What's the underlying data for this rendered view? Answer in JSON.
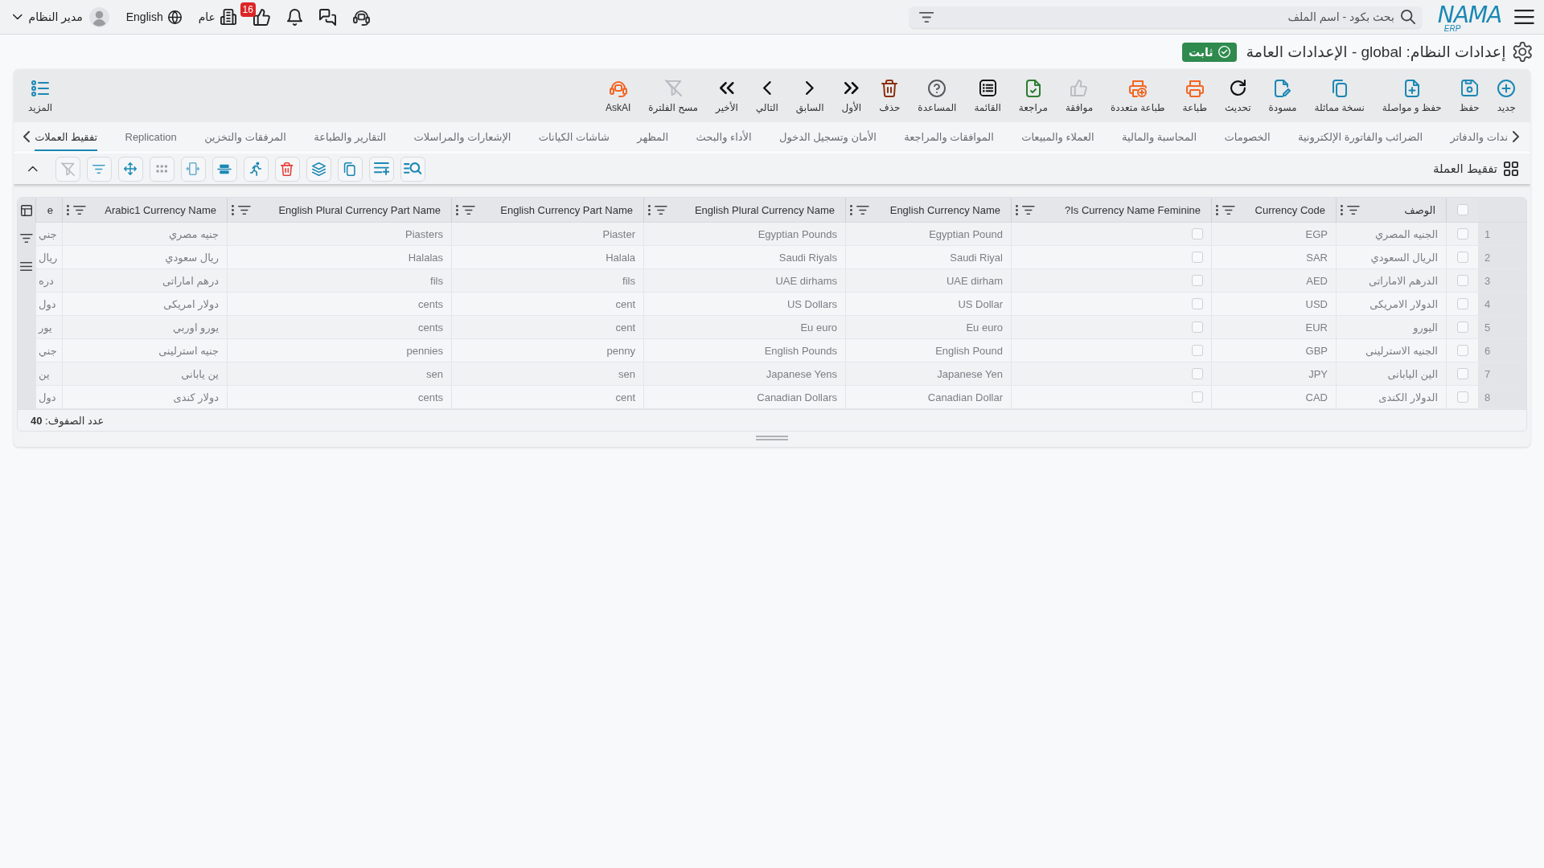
{
  "top_bar": {
    "logo": {
      "wordmark": "NAMA",
      "suffix": "ERP"
    },
    "search": {
      "placeholder": "بحث بكود - اسم الملف"
    },
    "approvals_badge": "16",
    "branch": "عام",
    "language": "English",
    "user": "مدير النظام"
  },
  "page": {
    "title": "إعدادات النظام: global - الإعدادات العامة",
    "status": "ثابت"
  },
  "toolbar": {
    "buttons": [
      {
        "kind": "new",
        "label": "جديد",
        "disabled": false
      },
      {
        "kind": "save",
        "label": "حفظ",
        "disabled": false
      },
      {
        "kind": "savenext",
        "label": "حفظ و مواصلة",
        "disabled": false
      },
      {
        "kind": "duplicate",
        "label": "نسخة مماثلة",
        "disabled": false
      },
      {
        "kind": "draft",
        "label": "مسودة",
        "disabled": false
      },
      {
        "kind": "refresh",
        "label": "تحديث",
        "disabled": false
      },
      {
        "kind": "print",
        "label": "طباعة",
        "disabled": false
      },
      {
        "kind": "multiprint",
        "label": "طباعة متعددة",
        "disabled": false
      },
      {
        "kind": "approve",
        "label": "موافقة",
        "disabled": true
      },
      {
        "kind": "review",
        "label": "مراجعة",
        "disabled": false
      },
      {
        "kind": "list",
        "label": "القائمة",
        "disabled": false
      },
      {
        "kind": "help",
        "label": "المساعدة",
        "disabled": false
      },
      {
        "kind": "delete",
        "label": "حذف",
        "disabled": false
      },
      {
        "kind": "first",
        "label": "الأول",
        "disabled": false
      },
      {
        "kind": "previous",
        "label": "السابق",
        "disabled": false
      },
      {
        "kind": "next",
        "label": "التالي",
        "disabled": false
      },
      {
        "kind": "last",
        "label": "الأخير",
        "disabled": false
      },
      {
        "kind": "clearfilter",
        "label": "مسح الفلترة",
        "disabled": true
      },
      {
        "kind": "askai",
        "label": "AskAI",
        "disabled": false
      }
    ],
    "more": "المزيد"
  },
  "tabs": [
    {
      "label": "ندات والدفاتر",
      "selected": false
    },
    {
      "label": "الضرائب والفاتورة الإلكترونية",
      "selected": false
    },
    {
      "label": "الخصومات",
      "selected": false
    },
    {
      "label": "المحاسبة والمالية",
      "selected": false
    },
    {
      "label": "العملاء والمبيعات",
      "selected": false
    },
    {
      "label": "الموافقات والمراجعة",
      "selected": false
    },
    {
      "label": "الأمان وتسجيل الدخول",
      "selected": false
    },
    {
      "label": "الأداء والبحث",
      "selected": false
    },
    {
      "label": "المظهر",
      "selected": false
    },
    {
      "label": "شاشات الكيانات",
      "selected": false
    },
    {
      "label": "الإشعارات والمراسلات",
      "selected": false
    },
    {
      "label": "التقارير والطباعة",
      "selected": false
    },
    {
      "label": "المرفقات والتخزين",
      "selected": false
    },
    {
      "label": "Replication",
      "selected": false
    },
    {
      "label": "تفقيط العملات",
      "selected": true
    }
  ],
  "section": {
    "title": "تفقيط العملة",
    "expanded": true,
    "tools": [
      {
        "kind": "searchlist",
        "disabled": false
      },
      {
        "kind": "addrow",
        "disabled": false
      },
      {
        "kind": "copy",
        "disabled": false
      },
      {
        "kind": "layers",
        "disabled": false
      },
      {
        "kind": "delete",
        "disabled": false
      },
      {
        "kind": "run",
        "disabled": false
      },
      {
        "kind": "freeze",
        "disabled": false
      },
      {
        "kind": "fit",
        "disabled": false
      },
      {
        "kind": "dots",
        "disabled": false
      },
      {
        "kind": "move",
        "disabled": false
      },
      {
        "kind": "filter",
        "disabled": false
      },
      {
        "kind": "clearfilter",
        "disabled": true
      }
    ]
  },
  "grid": {
    "all_selected": false,
    "columns": [
      {
        "kind": "text",
        "label": "الوصف"
      },
      {
        "kind": "text",
        "label": "Currency Code"
      },
      {
        "kind": "check",
        "label": "Is Currency Name Feminine?"
      },
      {
        "kind": "text",
        "label": "English Currency Name"
      },
      {
        "kind": "text",
        "label": "English Plural Currency Name"
      },
      {
        "kind": "text",
        "label": "English Currency Part Name"
      },
      {
        "kind": "text",
        "label": "English Plural Currency Part Name"
      },
      {
        "kind": "text",
        "label": "Arabic1 Currency Name"
      },
      {
        "kind": "text",
        "label": "e"
      }
    ],
    "rows": [
      {
        "number": "1",
        "selected": false,
        "cells": [
          "الجنيه المصري",
          "EGP",
          {
            "checked": false
          },
          "Egyptian Pound",
          "Egyptian Pounds",
          "Piaster",
          "Piasters",
          "جنيه مصري",
          "جني"
        ]
      },
      {
        "number": "2",
        "selected": false,
        "cells": [
          "الريال السعودي",
          "SAR",
          {
            "checked": false
          },
          "Saudi Riyal",
          "Saudi Riyals",
          "Halala",
          "Halalas",
          "ريال سعودي",
          "ريال"
        ]
      },
      {
        "number": "3",
        "selected": false,
        "cells": [
          "الدرهم الاماراتى",
          "AED",
          {
            "checked": false
          },
          "UAE dirham",
          "UAE dirhams",
          "fils",
          "fils",
          "درهم اماراتى",
          "دره"
        ]
      },
      {
        "number": "4",
        "selected": false,
        "cells": [
          "الدولار الامريكى",
          "USD",
          {
            "checked": false
          },
          "US Dollar",
          "US Dollars",
          "cent",
          "cents",
          "دولار امريكى",
          "دول"
        ]
      },
      {
        "number": "5",
        "selected": false,
        "cells": [
          "اليورو",
          "EUR",
          {
            "checked": false
          },
          "Eu euro",
          "Eu euro",
          "cent",
          "cents",
          "يورو اوربي",
          "يور"
        ]
      },
      {
        "number": "6",
        "selected": false,
        "cells": [
          "الجنيه الاسترلينى",
          "GBP",
          {
            "checked": false
          },
          "English Pound",
          "English Pounds",
          "penny",
          "pennies",
          "جنيه استرلينى",
          "جني"
        ]
      },
      {
        "number": "7",
        "selected": false,
        "cells": [
          "الين اليابانى",
          "JPY",
          {
            "checked": false
          },
          "Japanese Yen",
          "Japanese Yens",
          "sen",
          "sen",
          "ين يابانى",
          "ين"
        ]
      },
      {
        "number": "8",
        "selected": false,
        "cells": [
          "الدولار الكندى",
          "CAD",
          {
            "checked": false
          },
          "Canadian Dollar",
          "Canadian Dollars",
          "cent",
          "cents",
          "دولار كندى",
          "دول"
        ]
      }
    ],
    "footer": "عدد الصفوف: **40**"
  }
}
